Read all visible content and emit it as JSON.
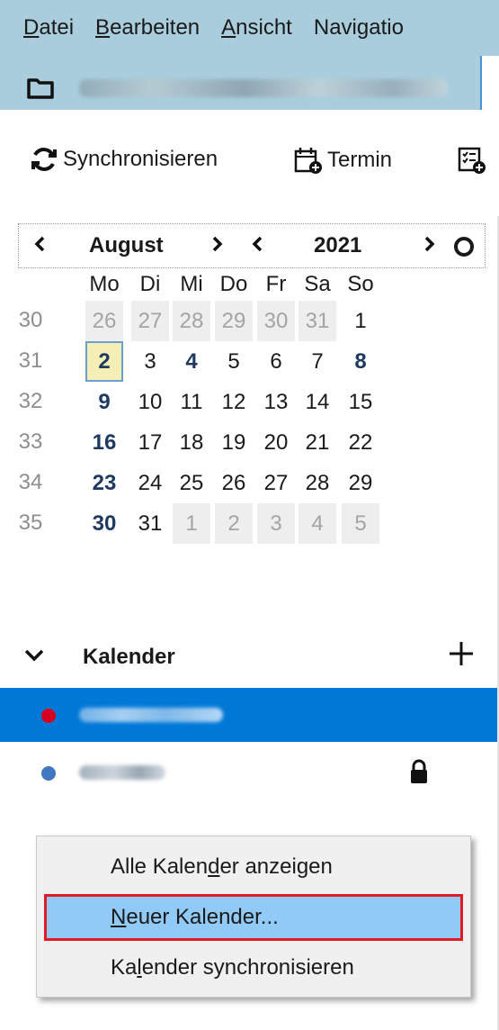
{
  "menubar": {
    "items": [
      {
        "pre": "",
        "key": "D",
        "post": "atei"
      },
      {
        "pre": "",
        "key": "B",
        "post": "earbeiten"
      },
      {
        "pre": "",
        "key": "A",
        "post": "nsicht"
      },
      {
        "pre": "Navi",
        "key": "g",
        "post": "atio"
      }
    ]
  },
  "toolbar": {
    "sync_label": "Synchronisieren",
    "event_label": "Termin"
  },
  "minimonth": {
    "month": "August",
    "year": "2021",
    "weekdays": [
      "Mo",
      "Di",
      "Mi",
      "Do",
      "Fr",
      "Sa",
      "So"
    ],
    "weeks": [
      {
        "week": "30",
        "days": [
          "26",
          "27",
          "28",
          "29",
          "30",
          "31",
          "1"
        ]
      },
      {
        "week": "31",
        "days": [
          "2",
          "3",
          "4",
          "5",
          "6",
          "7",
          "8"
        ]
      },
      {
        "week": "32",
        "days": [
          "9",
          "10",
          "11",
          "12",
          "13",
          "14",
          "15"
        ]
      },
      {
        "week": "33",
        "days": [
          "16",
          "17",
          "18",
          "19",
          "20",
          "21",
          "22"
        ]
      },
      {
        "week": "34",
        "days": [
          "23",
          "24",
          "25",
          "26",
          "27",
          "28",
          "29"
        ]
      },
      {
        "week": "35",
        "days": [
          "30",
          "31",
          "1",
          "2",
          "3",
          "4",
          "5"
        ]
      }
    ],
    "today": "2",
    "busy_days": [
      "4",
      "8",
      "9",
      "16",
      "23",
      "30"
    ]
  },
  "calendars": {
    "title": "Kalender",
    "items": [
      {
        "color": "#d70022",
        "selected": true,
        "locked": false
      },
      {
        "color": "#3f77c1",
        "selected": false,
        "locked": true
      }
    ]
  },
  "context_menu": {
    "items": [
      {
        "pre": "Alle Kalen",
        "key": "d",
        "post": "er anzeigen",
        "hover": false
      },
      {
        "pre": "",
        "key": "N",
        "post": "euer Kalender...",
        "hover": true
      },
      {
        "pre": "Ka",
        "key": "l",
        "post": "ender synchronisieren",
        "hover": false
      }
    ]
  },
  "colors": {
    "menubar_bg": "#a9cddc",
    "selection": "#0078d7",
    "menu_hover": "#91c9f7",
    "highlight_border": "#e01b24",
    "today_bg": "#f5eeb5"
  }
}
